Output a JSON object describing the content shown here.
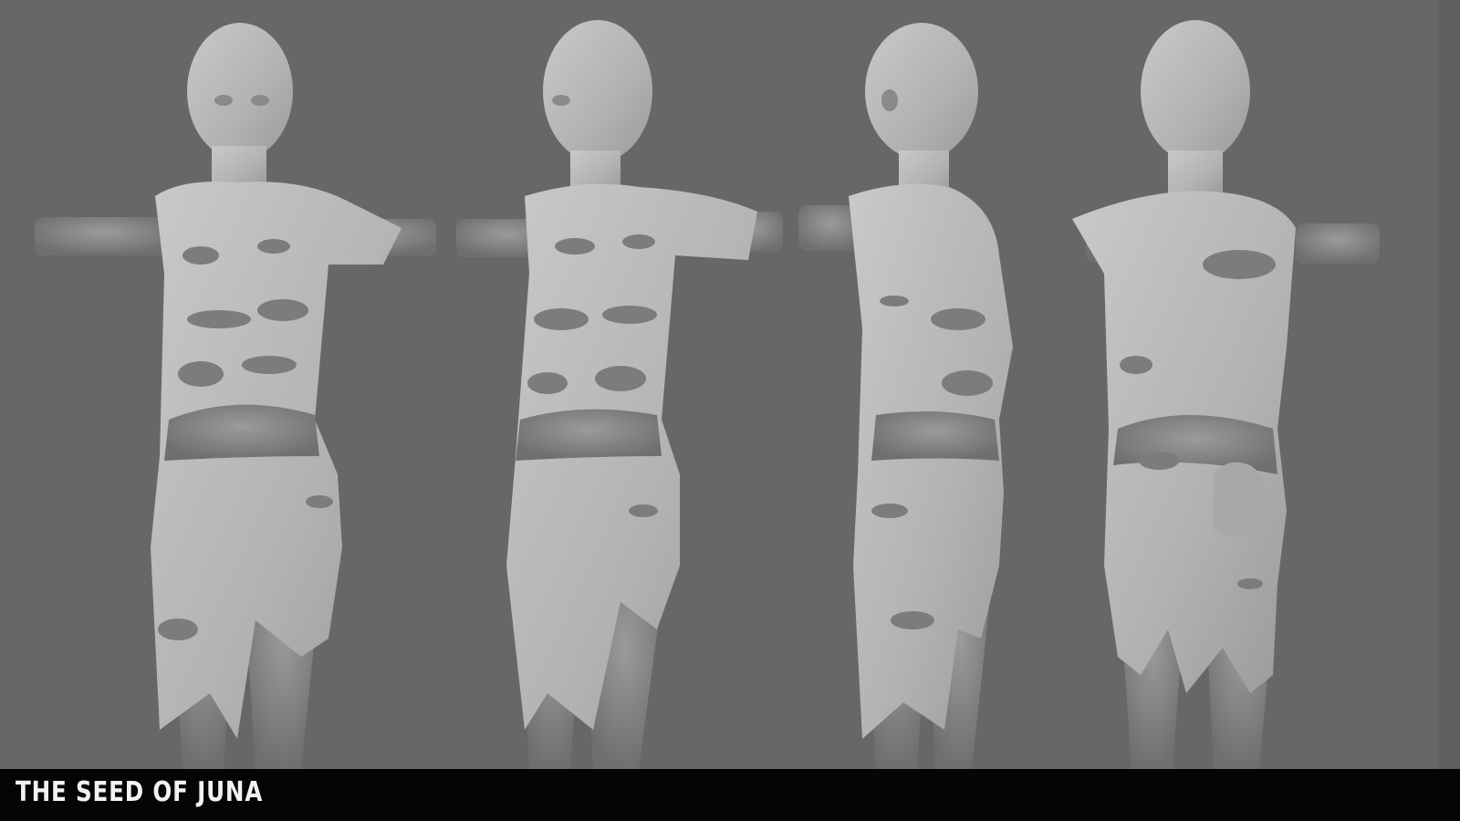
{
  "caption": {
    "title": "THE SEED OF JUNA"
  },
  "colors": {
    "background": "#676767",
    "skin": "#8f8f8f",
    "cloth": "#bdbdbd",
    "hole": "#7c7c7c",
    "caption_bar": "#050505",
    "caption_text": "#f2f2f2"
  },
  "figures": [
    {
      "view": "front"
    },
    {
      "view": "three-quarter"
    },
    {
      "view": "side"
    },
    {
      "view": "back"
    }
  ]
}
